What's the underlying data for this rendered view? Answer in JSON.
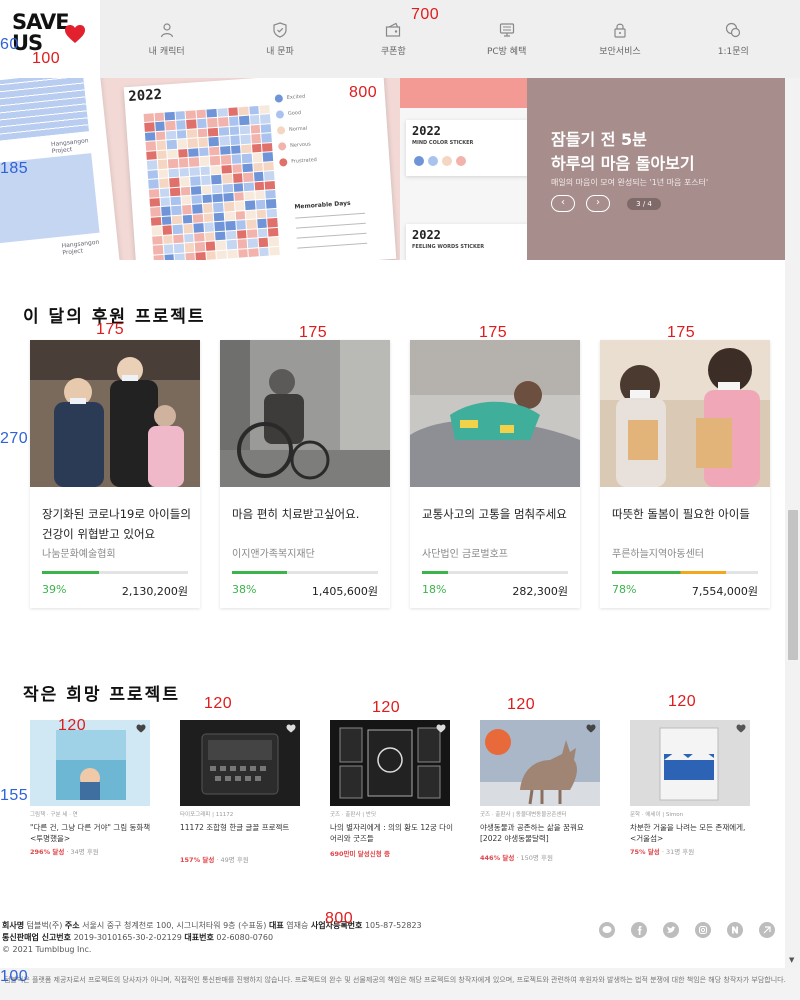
{
  "logo": {
    "line1": "SAVE",
    "line2": "US"
  },
  "nav": [
    {
      "label": "내 캐릭터",
      "icon": "user-icon"
    },
    {
      "label": "내 문파",
      "icon": "shield-icon"
    },
    {
      "label": "쿠폰함",
      "icon": "coupon-icon"
    },
    {
      "label": "PC방 혜택",
      "icon": "pc-icon"
    },
    {
      "label": "보안서비스",
      "icon": "lock-icon"
    },
    {
      "label": "1:1문의",
      "icon": "chat-icon"
    }
  ],
  "banner": {
    "year": "2022",
    "title": "잠들기 전 5분\n하루의 마음 돌아보기",
    "desc": "매일의 마음이 모여 완성되는 '1년 마음 포스터'",
    "page": "3 / 4",
    "prev": "‹",
    "next": "›",
    "sticker1": {
      "year": "2022",
      "sub": "MIND COLOR STICKER"
    },
    "sticker2": {
      "year": "2022",
      "sub": "FEELING WORDS STICKER"
    },
    "memorable": "Memorable Days",
    "legend": [
      "Excited",
      "Good",
      "Normal",
      "Nervous",
      "Frustrated"
    ],
    "hangsangon": "Hangsangon Project",
    "colors": {
      "panel": "#a78e8d",
      "pink": "#f3d9d6"
    }
  },
  "annotations": {
    "n100": "100",
    "n60": "60",
    "n700": "700",
    "n800a": "800",
    "n185": "185",
    "n175a": "175",
    "n175b": "175",
    "n175c": "175",
    "n175d": "175",
    "n270": "270",
    "n120a": "120",
    "n120b": "120",
    "n120c": "120",
    "n120d": "120",
    "n120e": "120",
    "n155": "155",
    "n800b": "800",
    "n100b": "100"
  },
  "monthly": {
    "title": "이 달의 후원 프로젝트",
    "cards": [
      {
        "title": "장기화된 코로나19로 아이들의 건강이 위협받고 있어요",
        "org": "나눔문화예술협회",
        "percent": "39%",
        "amount": "2,130,200원",
        "progress": 0.39,
        "bar_color": "#3bb44a"
      },
      {
        "title": "마음 편히 치료받고싶어요.",
        "org": "이지앤가족복지재단",
        "percent": "38%",
        "amount": "1,405,600원",
        "progress": 0.38,
        "bar_color": "#3bb44a"
      },
      {
        "title": "교통사고의 고통을 멈춰주세요",
        "org": "사단법인 금로벌호프",
        "percent": "18%",
        "amount": "282,300원",
        "progress": 0.18,
        "bar_color": "#3bb44a"
      },
      {
        "title": "따뜻한 돌봄이 필요한 아이들",
        "org": "푸른하늘지역아동센터",
        "percent": "78%",
        "amount": "7,554,000원",
        "progress": 0.78,
        "bar_color": "#3bb44a"
      }
    ]
  },
  "small": {
    "title": "작은 희망 프로젝트",
    "cards": [
      {
        "meta": "그림책 · 구분 세 · 연",
        "title": "\"다른 건, 그냥 다른 거야\" 그림 동화책 <투명했을>",
        "pct": "296% 달성",
        "backers": " · 34명 후원"
      },
      {
        "meta": "타이포그래피 | 11172",
        "title": "11172 조합형 한글 글꼴 프로젝트",
        "pct": "157% 달성",
        "backers": " · 49명 후원"
      },
      {
        "meta": "굿즈 · 출판사 | 반딧",
        "title": "나의 별자리에게 : 의의 황도 12궁 다이어리와 굿즈들",
        "pct": "690만미 달성신청 중",
        "backers": ""
      },
      {
        "meta": "굿즈 · 출판사 | 동물대변동물공존센터",
        "title": "야생동물과 공존하는 삶을 꿈꿔요 [2022 야생동물달력]",
        "pct": "446% 달성",
        "backers": " · 150명 후원"
      },
      {
        "meta": "문학 · 에세이 | Simon",
        "title": "차분한 거울을 나려는 모든 존재에게, <거울섬>",
        "pct": "75% 달성",
        "backers": " · 31명 후원"
      }
    ]
  },
  "footer": {
    "company_label": "회사명",
    "company": "텀블벅(주)",
    "address_label": "주소",
    "address": "서울시 중구 청계천로 100, 시그니처타워 9층 (수표동)",
    "ceo_label": "대표",
    "ceo": "염재승",
    "biz_label": "사업자등록번호",
    "biz": "105-87-52823",
    "mail_label": "통신판매업 신고번호",
    "mail": "2019-3010165-30-2-02129",
    "tel_label": "대표번호",
    "tel": "02-6080-0760",
    "copyright": "© 2021 Tumblbug Inc.",
    "notice": "텀블벅은 플랫폼 제공자로서 프로젝트의 당사자가 아니며, 직접적인 통신판매를 진행하지 않습니다. 프로젝트의 완수 및 선물제공의 책임은 해당 프로젝트의 창작자에게 있으며, 프로젝트와 관련하여 후원자와 발생하는 법적 분쟁에 대한 책임은 해당 창작자가 부담합니다.",
    "social": [
      "kakao-icon",
      "facebook-icon",
      "twitter-icon",
      "instagram-icon",
      "naver-icon",
      "brunch-icon"
    ]
  }
}
